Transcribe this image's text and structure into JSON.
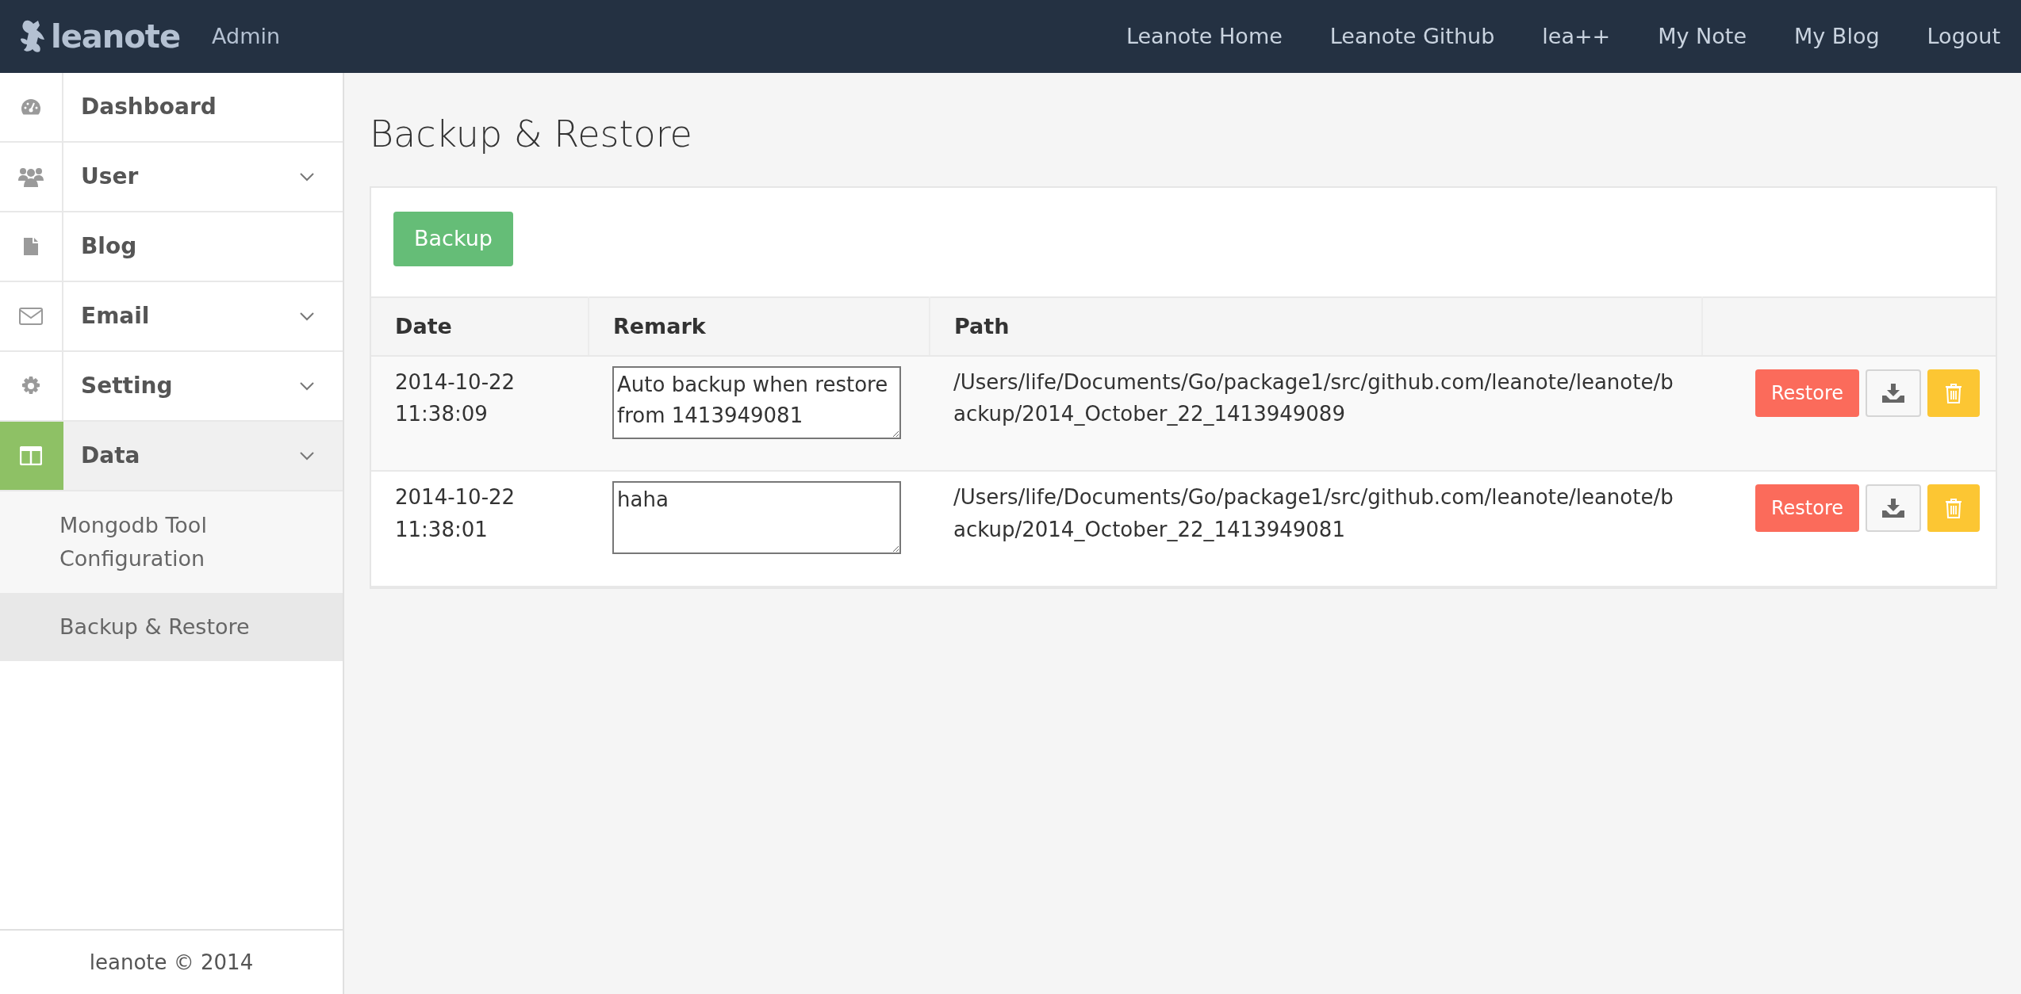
{
  "navbar": {
    "brand": "leanote",
    "section": "Admin",
    "links": [
      "Leanote Home",
      "Leanote Github",
      "lea++",
      "My Note",
      "My Blog",
      "Logout"
    ]
  },
  "sidebar": {
    "items": [
      {
        "label": "Dashboard",
        "expandable": false,
        "selected": false
      },
      {
        "label": "User",
        "expandable": true,
        "selected": false
      },
      {
        "label": "Blog",
        "expandable": false,
        "selected": false
      },
      {
        "label": "Email",
        "expandable": true,
        "selected": false
      },
      {
        "label": "Setting",
        "expandable": true,
        "selected": false
      },
      {
        "label": "Data",
        "expandable": true,
        "selected": true,
        "children": [
          {
            "label": "Mongodb Tool Configuration",
            "selected": false
          },
          {
            "label": "Backup & Restore",
            "selected": true
          }
        ]
      }
    ],
    "footer": "leanote © 2014"
  },
  "page_title": "Backup & Restore",
  "backup_button": "Backup",
  "table": {
    "columns": [
      "Date",
      "Remark",
      "Path"
    ],
    "rows": [
      {
        "date": "2014-10-22 11:38:09",
        "remark": "Auto backup when restore from 1413949081",
        "path": "/Users/life/Documents/Go/package1/src/github.com/leanote/leanote/backup/2014_October_22_1413949089",
        "restore": "Restore"
      },
      {
        "date": "2014-10-22 11:38:01",
        "remark": "haha",
        "path": "/Users/life/Documents/Go/package1/src/github.com/leanote/leanote/backup/2014_October_22_1413949081",
        "restore": "Restore"
      }
    ]
  }
}
